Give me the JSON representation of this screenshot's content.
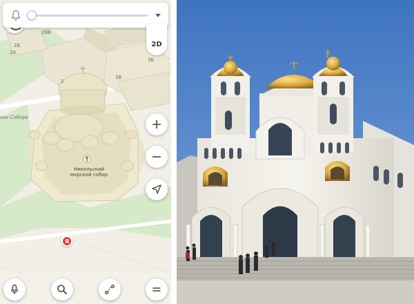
{
  "top_bar": {
    "bell_icon": "bell-icon",
    "slider_fraction": 0.0,
    "dropdown_icon": "chevron-down-icon"
  },
  "map": {
    "view_mode": "2D",
    "building_numbers": [
      "26В",
      "2Б",
      "2А",
      "3Б",
      "2",
      "3В"
    ],
    "street_label": "ого Собора",
    "poi": {
      "line1": "Никольский",
      "line2": "морской собор"
    },
    "pin_label": "Я",
    "zoom_controls": [
      "plus-icon",
      "minus-icon"
    ],
    "locate_icon": "location-arrow-icon"
  },
  "bottom_toolbar": {
    "icons": [
      "microphone-icon",
      "search-icon",
      "route-icon",
      "menu-icon"
    ]
  },
  "colors": {
    "map_background": "#f2efe6",
    "park_green": "#d3e8c4",
    "building": "#ece8d6",
    "pin_red": "#e53935",
    "sky_blue": "#4a7ec4",
    "cathedral_white": "#f1efe8",
    "dome_gold": "#d9a63a"
  }
}
